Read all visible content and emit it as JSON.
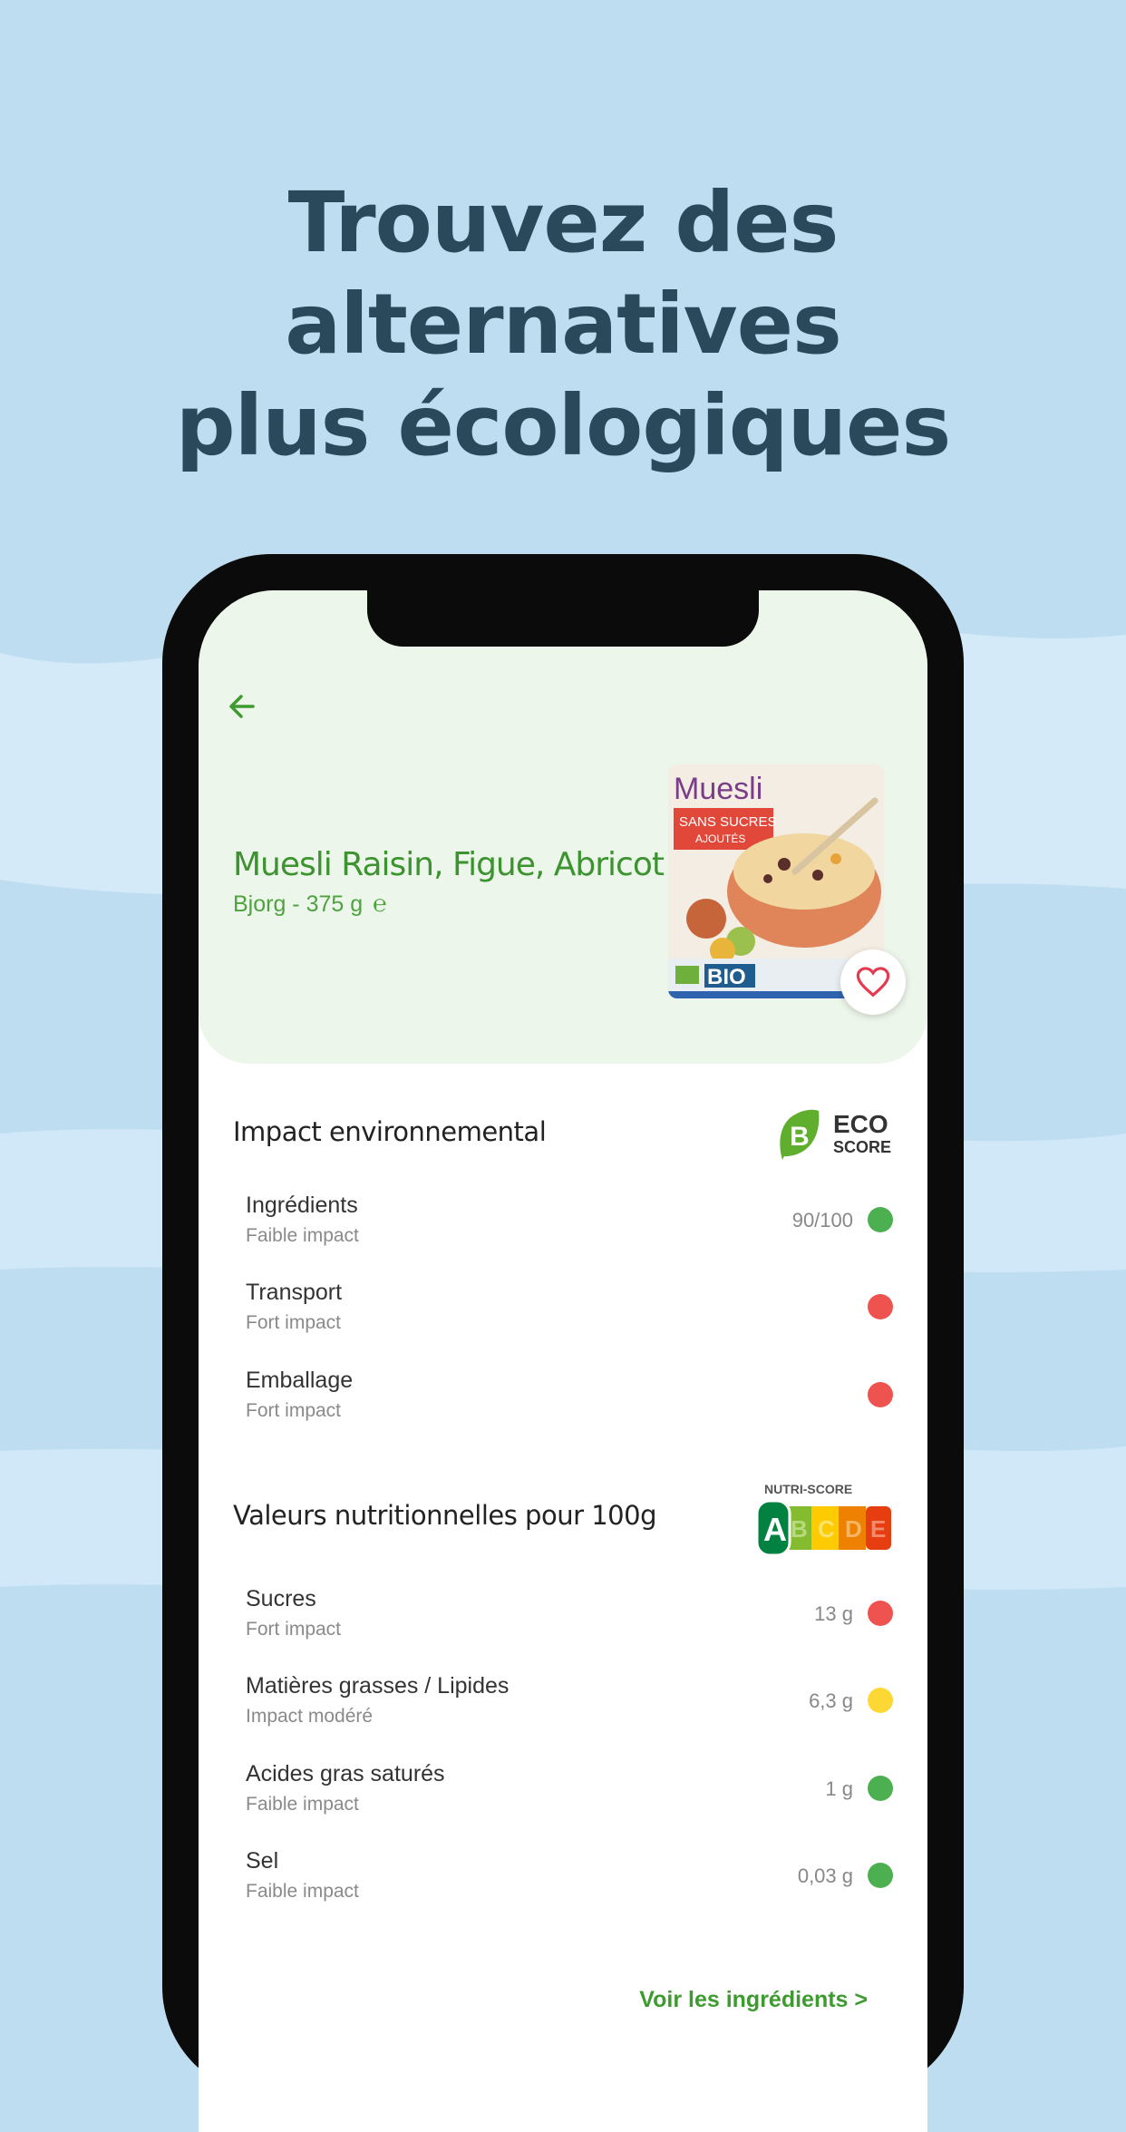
{
  "headline": {
    "line1": "Trouvez des alternatives",
    "line2": "plus écologiques"
  },
  "product": {
    "name": "Muesli Raisin, Figue, Abricot",
    "subtitle": "Bjorg - 375 g",
    "estimated_icon": "℮",
    "image_text": {
      "title": "Muesli",
      "banner1": "SANS SUCRES",
      "banner2": "AJOUTÉS",
      "bio": "BIO"
    }
  },
  "environment": {
    "title": "Impact environnemental",
    "eco_score": {
      "grade": "B",
      "label_top": "ECO",
      "label_bottom": "SCORE"
    },
    "rows": [
      {
        "label": "Ingrédients",
        "desc": "Faible impact",
        "value": "90/100",
        "color": "#4caf50"
      },
      {
        "label": "Transport",
        "desc": "Fort impact",
        "value": "",
        "color": "#ef5350"
      },
      {
        "label": "Emballage",
        "desc": "Fort impact",
        "value": "",
        "color": "#ef5350"
      }
    ]
  },
  "nutrition": {
    "title": "Valeurs nutritionnelles pour 100g",
    "nutri_score": {
      "caption": "NUTRI-SCORE",
      "grades": [
        "A",
        "B",
        "C",
        "D",
        "E"
      ],
      "selected": "A"
    },
    "rows": [
      {
        "label": "Sucres",
        "desc": "Fort impact",
        "value": "13 g",
        "color": "#ef5350"
      },
      {
        "label": "Matières grasses / Lipides",
        "desc": "Impact modéré",
        "value": "6,3 g",
        "color": "#fdd835"
      },
      {
        "label": "Acides gras saturés",
        "desc": "Faible impact",
        "value": "1 g",
        "color": "#4caf50"
      },
      {
        "label": "Sel",
        "desc": "Faible impact",
        "value": "0,03 g",
        "color": "#4caf50"
      }
    ]
  },
  "link_label": "Voir les ingrédients >"
}
